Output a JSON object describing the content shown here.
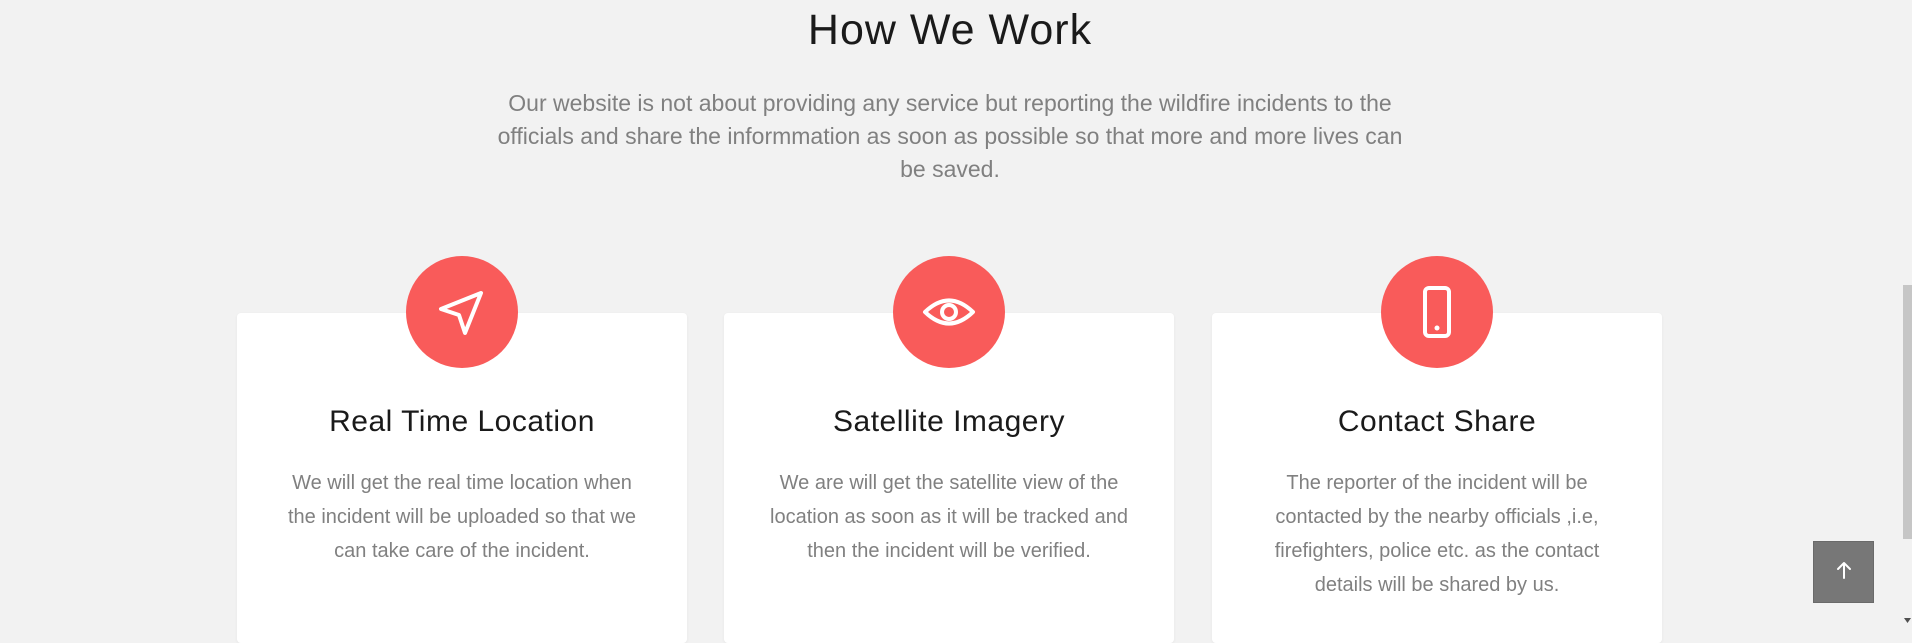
{
  "section": {
    "title": "How We Work",
    "intro": "Our website is not about providing any service but reporting the wildfire incidents to the officials and share the informmation as soon as possible so that more and more lives can be saved."
  },
  "cards": [
    {
      "icon": "navigation-arrow-icon",
      "title": "Real Time Location",
      "text": "We will get the real time location when the incident will be uploaded so that we can take care of the incident."
    },
    {
      "icon": "eye-icon",
      "title": "Satellite Imagery",
      "text": "We are will get the satellite view of the location as soon as it will be tracked and then the incident will be verified."
    },
    {
      "icon": "smartphone-icon",
      "title": "Contact Share",
      "text": "The reporter of the incident will be contacted by the nearby officials ,i.e, firefighters, police etc. as the contact details will be shared by us."
    }
  ],
  "back_to_top": {
    "icon": "arrow-up-icon"
  },
  "colors": {
    "accent": "#f95b5a",
    "background": "#f2f2f2",
    "card": "#ffffff",
    "heading": "#1a1a1a",
    "body_text": "#808080",
    "button": "#777777"
  }
}
